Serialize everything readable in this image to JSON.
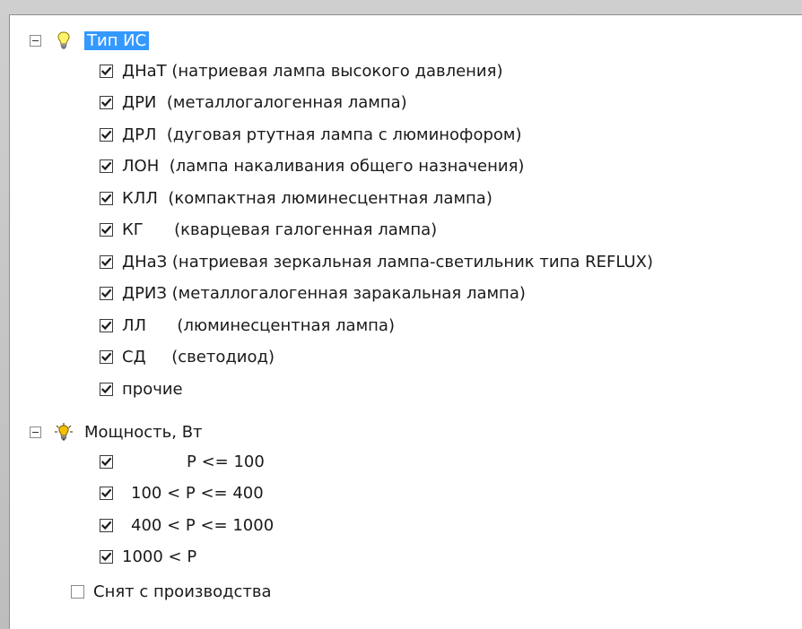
{
  "tree": {
    "group_type": {
      "label": "Тип ИС",
      "expander": "minus-box-icon",
      "icon": "lightbulb-icon",
      "items": [
        {
          "code": "ДНаТ",
          "gap": " ",
          "desc": "(натриевая лампа высокого давления)",
          "checked": true
        },
        {
          "code": "ДРИ",
          "gap": "  ",
          "desc": "(металлогалогенная лампа)",
          "checked": true
        },
        {
          "code": "ДРЛ",
          "gap": "  ",
          "desc": "(дуговая ртутная лампа с люминофором)",
          "checked": true
        },
        {
          "code": "ЛОН",
          "gap": "  ",
          "desc": "(лампа накаливания общего назначения)",
          "checked": true
        },
        {
          "code": "КЛЛ",
          "gap": "  ",
          "desc": "(компактная люминесцентная лампа)",
          "checked": true
        },
        {
          "code": "КГ",
          "gap": "      ",
          "desc": "(кварцевая галогенная лампа)",
          "checked": true
        },
        {
          "code": "ДНаЗ",
          "gap": " ",
          "desc": "(натриевая зеркальная лампа-светильник типа REFLUX)",
          "checked": true
        },
        {
          "code": "ДРИЗ",
          "gap": " ",
          "desc": "(металлогалогенная заракальная лампа)",
          "checked": true
        },
        {
          "code": "ЛЛ",
          "gap": "      ",
          "desc": "(люминесцентная лампа)",
          "checked": true
        },
        {
          "code": "СД",
          "gap": "     ",
          "desc": "(светодиод)",
          "checked": true
        },
        {
          "code": "прочие",
          "gap": "",
          "desc": "",
          "checked": true
        }
      ]
    },
    "group_power": {
      "label": "Мощность, Вт",
      "expander": "minus-box-icon",
      "icon": "power-bulb-icon",
      "items": [
        {
          "label": "P <= 100",
          "checked": true
        },
        {
          "label": "100 < P <= 400",
          "checked": true
        },
        {
          "label": "400 < P <= 1000",
          "checked": true
        },
        {
          "label": "1000 < P",
          "checked": true
        }
      ]
    },
    "discontinued": {
      "label": "Снят с производства",
      "checked": false
    }
  }
}
